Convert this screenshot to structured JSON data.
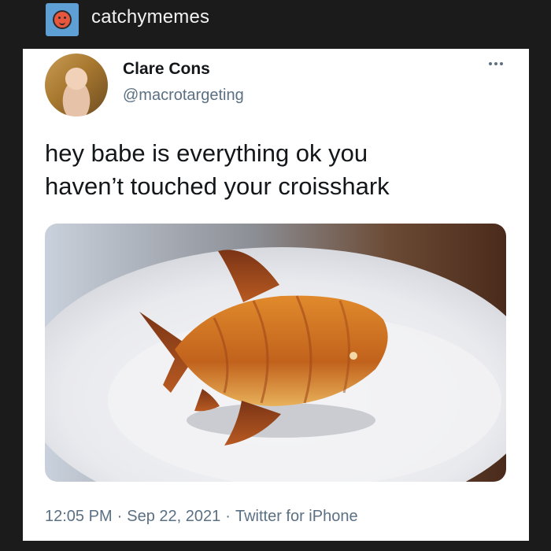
{
  "header": {
    "blog_name": "catchymemes",
    "avatar_icon": "smiley-face-icon"
  },
  "tweet": {
    "author_name": "Clare Cons",
    "author_handle": "@macrotargeting",
    "text_line1": "hey babe is everything ok you",
    "text_line2": "haven’t touched your croisshark",
    "time": "12:05 PM",
    "date": "Sep 22, 2021",
    "source": "Twitter for iPhone",
    "separator": "·",
    "more_icon": "more-options-icon"
  },
  "colors": {
    "page_background": "#1b1b1b",
    "card_background": "#ffffff",
    "secondary_text": "#5b7083",
    "primary_text": "#14171a"
  }
}
